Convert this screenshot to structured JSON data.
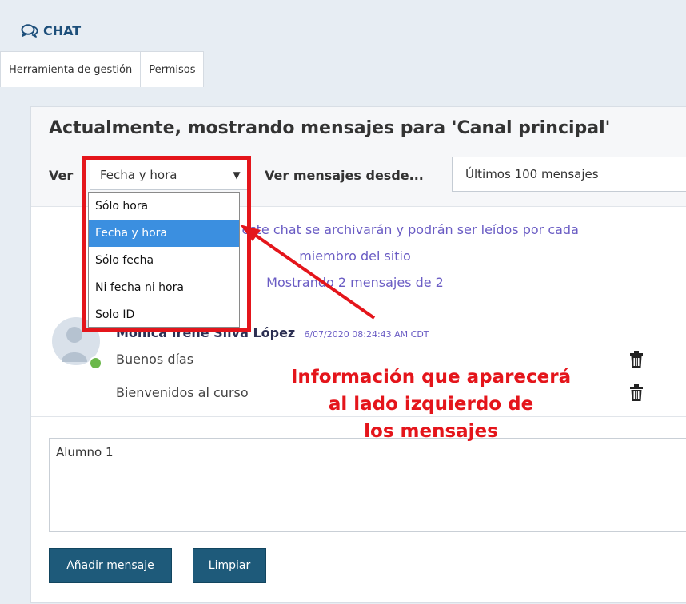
{
  "app": {
    "title": "CHAT"
  },
  "tabs": [
    "Herramienta de gestión",
    "Permisos"
  ],
  "header": {
    "heading": "Actualmente, mostrando mensajes para 'Canal principal'",
    "ver_label": "Ver",
    "ver_value": "Fecha y hora",
    "desde_label": "Ver mensajes desde...",
    "desde_value": "Últimos 100 mensajes"
  },
  "info": {
    "line1": "Los mensajes de este chat se archivarán y podrán ser leídos por cada",
    "line2": "miembro del sitio",
    "line3": "Mostrando 2 mensajes de 2"
  },
  "message": {
    "author": "Mónica Irene Silva López",
    "timestamp": "6/07/2020 08:24:43 AM CDT",
    "lines": [
      "Buenos días",
      "Bienvenidos al curso"
    ]
  },
  "composer": {
    "text": "Alumno 1"
  },
  "buttons": {
    "add": "Añadir mensaje",
    "clear": "Limpiar"
  },
  "dropdown": {
    "options": [
      "Sólo hora",
      "Fecha y hora",
      "Sólo fecha",
      "Ni fecha ni hora",
      "Solo ID"
    ],
    "selected_index": 1
  },
  "annotation": {
    "line1": "Información que aparecerá",
    "line2": "al lado izquierdo de",
    "line3": "los mensajes"
  },
  "colors": {
    "accent": "#1e5a7a",
    "annotation_red": "#e4151b",
    "info_text": "#6a5cc4",
    "selected_option": "#3b8fe0"
  }
}
